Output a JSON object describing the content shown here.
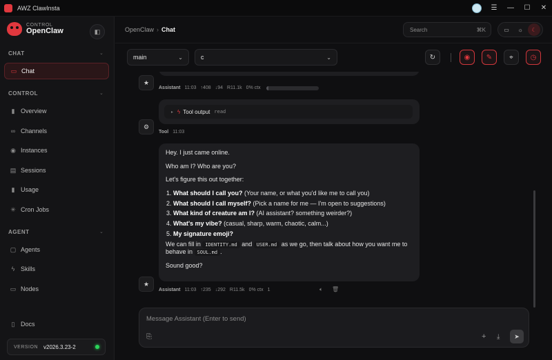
{
  "window": {
    "title": "AWZ ClawInsta"
  },
  "brand": {
    "subtitle": "CONTROL",
    "name": "OpenClaw"
  },
  "sidebar": {
    "sections": [
      {
        "label": "CHAT",
        "items": [
          {
            "label": "Chat",
            "icon": "chat-bubble-icon",
            "active": true
          }
        ]
      },
      {
        "label": "CONTROL",
        "items": [
          {
            "label": "Overview",
            "icon": "bar-chart-icon"
          },
          {
            "label": "Channels",
            "icon": "link-icon"
          },
          {
            "label": "Instances",
            "icon": "radio-icon"
          },
          {
            "label": "Sessions",
            "icon": "document-icon"
          },
          {
            "label": "Usage",
            "icon": "bar-chart-icon"
          },
          {
            "label": "Cron Jobs",
            "icon": "loader-icon"
          }
        ]
      },
      {
        "label": "AGENT",
        "items": [
          {
            "label": "Agents",
            "icon": "folder-icon"
          },
          {
            "label": "Skills",
            "icon": "lightning-icon"
          },
          {
            "label": "Nodes",
            "icon": "monitor-icon"
          }
        ]
      }
    ],
    "docs_label": "Docs",
    "version": {
      "label": "VERSION",
      "value": "v2026.3.23-2",
      "status_color": "#2bd45a"
    }
  },
  "header": {
    "breadcrumb": {
      "parent": "OpenClaw",
      "current": "Chat"
    },
    "search": {
      "placeholder": "Search",
      "shortcut": "⌘K"
    }
  },
  "toolbar": {
    "session_select": {
      "value": "main"
    },
    "model_select": {
      "value": "c"
    }
  },
  "messages": [
    {
      "role": "Assistant",
      "time": "11:03",
      "tokens_up": "↑408",
      "tokens_down": "↓94",
      "cost": "R11.1k",
      "ctx": "0% ctx",
      "ctx_fraction": 0.05
    },
    {
      "role": "Tool",
      "time": "11:03",
      "tool_label": "Tool output",
      "tool_name": "read"
    },
    {
      "role": "Assistant",
      "time": "11:03",
      "tokens_up": "↑235",
      "tokens_down": "↓292",
      "cost": "R11.5k",
      "ctx": "0% ctx",
      "extra": "1",
      "p1": "Hey. I just came online.",
      "p2": "Who am I? Who are you?",
      "p3": "Let's figure this out together:",
      "list": [
        {
          "bold": "What should I call you?",
          "rest": " (Your name, or what you'd like me to call you)"
        },
        {
          "bold": "What should I call myself?",
          "rest": " (Pick a name for me — I'm open to suggestions)"
        },
        {
          "bold": "What kind of creature am I?",
          "rest": " (AI assistant? something weirder?)"
        },
        {
          "bold": "What's my vibe?",
          "rest": " (casual, sharp, warm, chaotic, calm...)"
        },
        {
          "bold": "My signature emoji?",
          "rest": ""
        }
      ],
      "fill_a": "We can fill in ",
      "file1": "IDENTITY.md",
      "fill_b": " and ",
      "file2": "USER.md",
      "fill_c": " as we go, then talk about how you want me to behave in ",
      "file3": "SOUL.md",
      "fill_d": ".",
      "p_end": "Sound good?"
    }
  ],
  "composer": {
    "placeholder": "Message Assistant (Enter to send)"
  },
  "colors": {
    "accent": "#e0383e",
    "background": "#0f0f11",
    "sidebar": "#141416",
    "bubble": "#1e1e21"
  }
}
